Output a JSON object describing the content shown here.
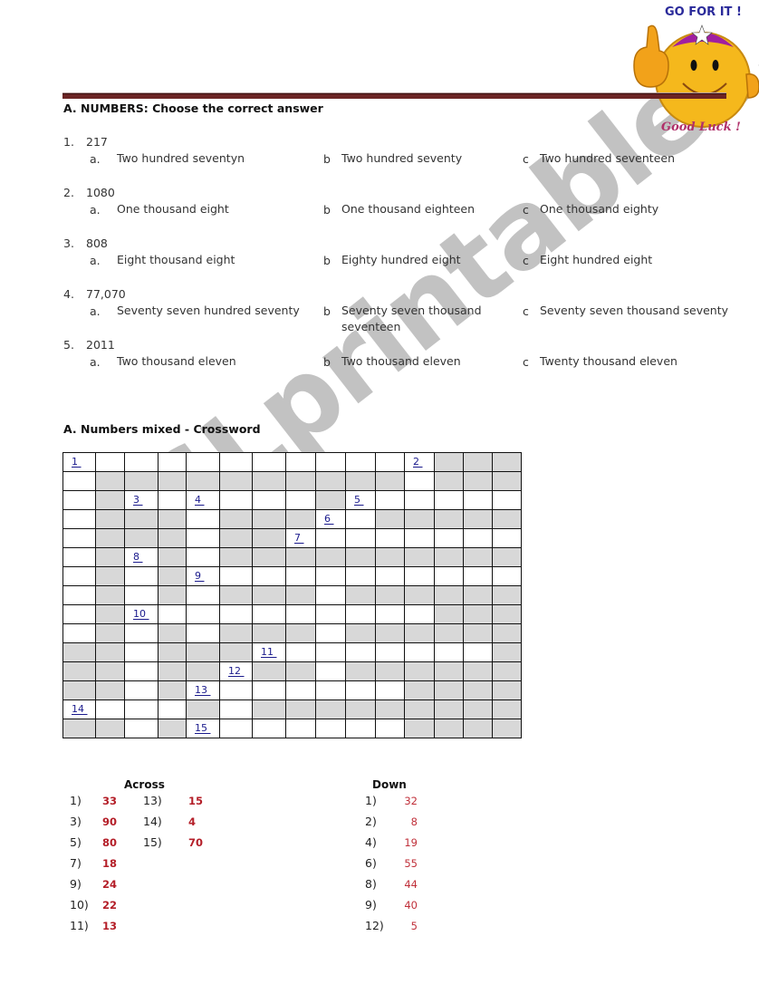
{
  "mascot": {
    "top_text": "GO FOR IT !",
    "bottom_text": "Good Luck !",
    "icon": "thumbs-up-smiley"
  },
  "section_a": {
    "title": "A.   NUMBERS: Choose the correct answer",
    "questions": [
      {
        "num": "1.",
        "value": "217",
        "options": [
          {
            "letter": "a.",
            "text": "Two hundred seventyn"
          },
          {
            "letter": "b",
            "text": "Two hundred seventy"
          },
          {
            "letter": "c",
            "text": "Two hundred seventeen"
          }
        ]
      },
      {
        "num": "2.",
        "value": "1080",
        "options": [
          {
            "letter": "a.",
            "text": "One thousand eight"
          },
          {
            "letter": "b",
            "text": "One thousand eighteen"
          },
          {
            "letter": "c",
            "text": "One thousand eighty"
          }
        ]
      },
      {
        "num": "3.",
        "value": "808",
        "options": [
          {
            "letter": "a.",
            "text": "Eight thousand eight"
          },
          {
            "letter": "b",
            "text": "Eighty hundred eight"
          },
          {
            "letter": "c",
            "text": "Eight hundred eight"
          }
        ]
      },
      {
        "num": "4.",
        "value": "77,070",
        "options": [
          {
            "letter": "a.",
            "text": "Seventy seven hundred seventy"
          },
          {
            "letter": "b",
            "text": "Seventy seven thousand seventeen"
          },
          {
            "letter": "c",
            "text": "Seventy seven thousand seventy"
          }
        ]
      },
      {
        "num": "5.",
        "value": "2011",
        "options": [
          {
            "letter": "a.",
            "text": "Two thousand eleven"
          },
          {
            "letter": "b",
            "text": "Two thousand eleven"
          },
          {
            "letter": "c",
            "text": "Twenty thousand eleven"
          }
        ]
      }
    ]
  },
  "section_b": {
    "title": "A.   Numbers mixed - Crossword",
    "grid": [
      "WWWWWWWWWWWWGGG",
      "WGGGGGGGGGGWGGG",
      "WGWWWWWWGWWWWWW",
      "WGGGWGGGWWGGGGG",
      "WGGGWGGWWWWWWWW",
      "WGWGWGGGGGGGGGG",
      "WGWGWWWWWWWWWWW",
      "WGWGWGGGWGGGGGG",
      "WGWWWWWWWWWWGGG",
      "WGWGWGGGWGGGGGG",
      "GGWGGGWWWWWWWWG",
      "GGWGGWGGWGGGGGG",
      "GGWGWWWWWWWGGGG",
      "WWWWGWGGGGGGGGG",
      "GGWGWWWWWWWGGGG"
    ],
    "labels": [
      {
        "row": 0,
        "col": 0,
        "text": "1"
      },
      {
        "row": 0,
        "col": 11,
        "text": "2"
      },
      {
        "row": 2,
        "col": 2,
        "text": "3"
      },
      {
        "row": 2,
        "col": 4,
        "text": "4"
      },
      {
        "row": 2,
        "col": 9,
        "text": "5"
      },
      {
        "row": 3,
        "col": 8,
        "text": "6"
      },
      {
        "row": 4,
        "col": 7,
        "text": "7"
      },
      {
        "row": 5,
        "col": 2,
        "text": "8"
      },
      {
        "row": 6,
        "col": 4,
        "text": "9"
      },
      {
        "row": 8,
        "col": 2,
        "text": "10"
      },
      {
        "row": 10,
        "col": 6,
        "text": "11"
      },
      {
        "row": 11,
        "col": 5,
        "text": "12"
      },
      {
        "row": 12,
        "col": 4,
        "text": "13"
      },
      {
        "row": 13,
        "col": 0,
        "text": "14"
      },
      {
        "row": 14,
        "col": 4,
        "text": "15"
      }
    ]
  },
  "clues": {
    "across_title": "Across",
    "down_title": "Down",
    "across": [
      {
        "label": "1)",
        "value": "33"
      },
      {
        "label": "3)",
        "value": "90"
      },
      {
        "label": "5)",
        "value": "80"
      },
      {
        "label": "7)",
        "value": "18"
      },
      {
        "label": "9)",
        "value": "24"
      },
      {
        "label": "10)",
        "value": "22"
      },
      {
        "label": "11)",
        "value": "13"
      },
      {
        "label": "13)",
        "value": "15"
      },
      {
        "label": "14)",
        "value": "4"
      },
      {
        "label": "15)",
        "value": "70"
      }
    ],
    "down": [
      {
        "label": "1)",
        "value": "32"
      },
      {
        "label": "2)",
        "value": "8"
      },
      {
        "label": "4)",
        "value": "19"
      },
      {
        "label": "6)",
        "value": "55"
      },
      {
        "label": "8)",
        "value": "44"
      },
      {
        "label": "9)",
        "value": "40"
      },
      {
        "label": "12)",
        "value": "5"
      }
    ]
  },
  "watermark": "ESLprintables.com"
}
